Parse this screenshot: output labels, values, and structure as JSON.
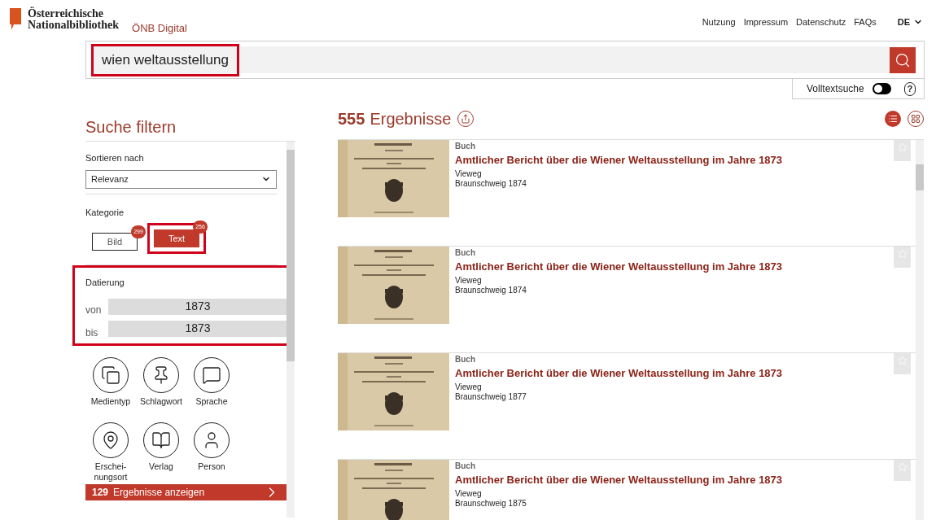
{
  "header": {
    "logo_lines": [
      "Österreichische",
      "Nationalbibliothek"
    ],
    "site_name": "ÖNB Digital",
    "nav": [
      "Nutzung",
      "Impressum",
      "Datenschutz",
      "FAQs"
    ],
    "language": "DE"
  },
  "search": {
    "value": "wien weltausstellung",
    "highlighted": true,
    "fulltext": {
      "label": "Volltextsuche",
      "on": false
    },
    "help": "?"
  },
  "filter": {
    "title": "Suche filtern",
    "sort": {
      "label": "Sortieren nach",
      "value": "Relevanz"
    },
    "category": {
      "label": "Kategorie",
      "options": [
        {
          "label": "Bild",
          "count": "299",
          "selected": false,
          "highlighted": false
        },
        {
          "label": "Text",
          "count": "256",
          "selected": true,
          "highlighted": true
        }
      ]
    },
    "dating": {
      "label": "Datierung",
      "highlighted": true,
      "from_label": "von",
      "from": "1873",
      "to_label": "bis",
      "to": "1873"
    },
    "facets": [
      {
        "kind": "media",
        "label": "Medientyp"
      },
      {
        "kind": "tag",
        "label": "Schlagwort"
      },
      {
        "kind": "language",
        "label": "Sprache"
      },
      {
        "kind": "place",
        "label": "Erschei-\nnungsort"
      },
      {
        "kind": "publisher",
        "label": "Verlag"
      },
      {
        "kind": "person",
        "label": "Person"
      }
    ],
    "apply": {
      "count": "129",
      "label": "Ergebnisse anzeigen"
    }
  },
  "results": {
    "count": "555",
    "label": "Ergebnisse",
    "view_modes": [
      {
        "kind": "list",
        "selected": true
      },
      {
        "kind": "grid",
        "selected": false
      }
    ],
    "items": [
      {
        "type": "Buch",
        "title": "Amtlicher Bericht über die Wiener Weltausstellung im Jahre 1873",
        "publisher": "Vieweg",
        "place_year": "Braunschweig 1874",
        "starred": false
      },
      {
        "type": "Buch",
        "title": "Amtlicher Bericht über die Wiener Weltausstellung im Jahre 1873",
        "publisher": "Vieweg",
        "place_year": "Braunschweig 1874",
        "starred": false
      },
      {
        "type": "Buch",
        "title": "Amtlicher Bericht über die Wiener Weltausstellung im Jahre 1873",
        "publisher": "Vieweg",
        "place_year": "Braunschweig 1877",
        "starred": false
      },
      {
        "type": "Buch",
        "title": "Amtlicher Bericht über die Wiener Weltausstellung im Jahre 1873",
        "publisher": "Vieweg",
        "place_year": "Braunschweig 1875",
        "starred": false
      }
    ]
  }
}
